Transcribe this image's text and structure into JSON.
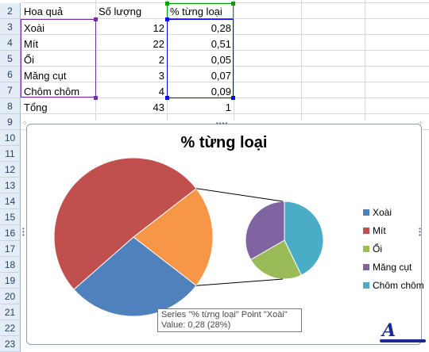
{
  "rows": [
    "2",
    "3",
    "4",
    "5",
    "6",
    "7",
    "8",
    "9",
    "10",
    "11",
    "12",
    "13",
    "14",
    "15",
    "16",
    "17",
    "18",
    "19",
    "20",
    "21",
    "22",
    "23"
  ],
  "headers": {
    "fruit": "Hoa quả",
    "qty": "Số lượng",
    "pct": "% từng loại"
  },
  "table": [
    {
      "fruit": "Xoài",
      "qty": "12",
      "pct": "0,28"
    },
    {
      "fruit": "Mít",
      "qty": "22",
      "pct": "0,51"
    },
    {
      "fruit": "Ổi",
      "qty": "2",
      "pct": "0,05"
    },
    {
      "fruit": "Măng cụt",
      "qty": "3",
      "pct": "0,07"
    },
    {
      "fruit": "Chôm chôm",
      "qty": "4",
      "pct": "0,09"
    }
  ],
  "total": {
    "label": "Tổng",
    "qty": "43",
    "pct": "1"
  },
  "chart_data": {
    "type": "pie",
    "title": "% từng loại",
    "categories": [
      "Xoài",
      "Mít",
      "Ổi",
      "Măng cụt",
      "Chôm chôm"
    ],
    "values": [
      0.28,
      0.51,
      0.05,
      0.07,
      0.09
    ],
    "colors": [
      "#4f81bd",
      "#c0504d",
      "#9bbb59",
      "#8064a2",
      "#4bacc6"
    ],
    "secondary_color": "#f79646",
    "subtype": "pie-of-pie",
    "secondary_plot_categories": [
      "Ổi",
      "Măng cụt",
      "Chôm chôm"
    ],
    "legend_position": "right"
  },
  "tooltip": {
    "line1": "Series \"% từng loại\" Point \"Xoài\"",
    "line2": "Value: 0,28 (28%)"
  },
  "colors": {
    "purple_range": "#7030a0",
    "green_range": "#00a000",
    "blue_range": "#0000ff"
  }
}
